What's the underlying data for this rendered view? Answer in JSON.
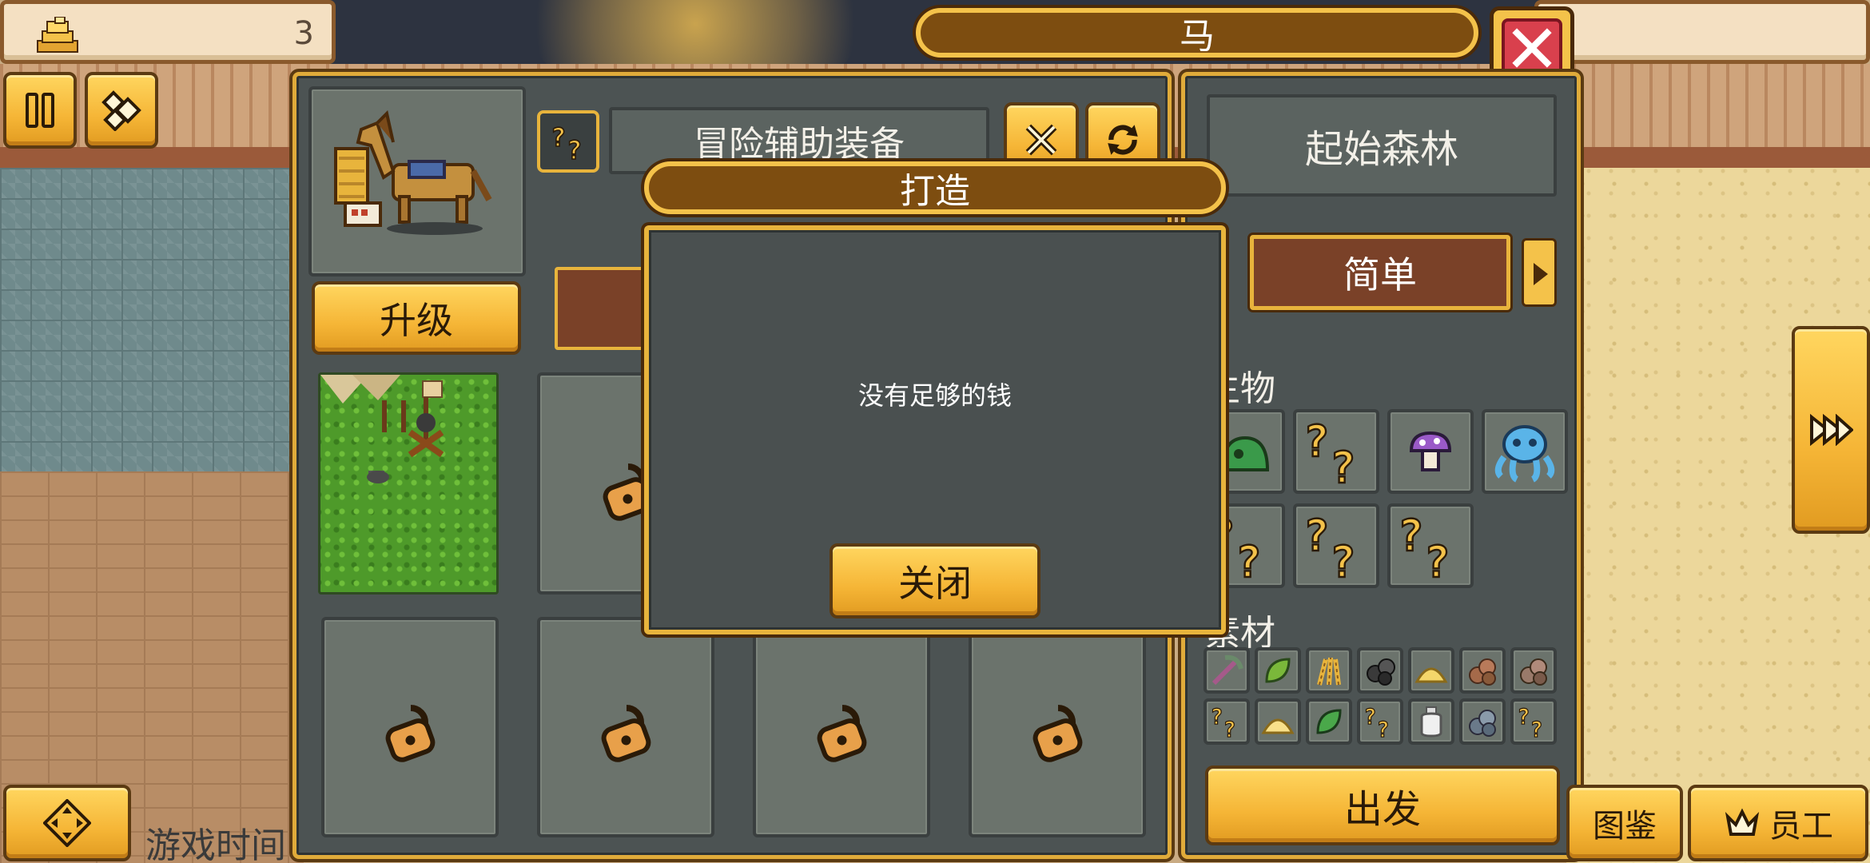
{
  "hud": {
    "coins": "3",
    "game_time_label": "游戏时间"
  },
  "header": {
    "title": "马"
  },
  "station": {
    "upgrade_label": "升级",
    "category_label": "冒险辅助装备",
    "slots_locked": 7
  },
  "expedition": {
    "region": "起始森林",
    "difficulty": "简单",
    "creatures_label": "生物",
    "materials_label": "素材",
    "depart_label": "出发"
  },
  "bottom_nav": {
    "dex_label": "图鉴",
    "staff_label": "员工"
  },
  "modal": {
    "title": "打造",
    "message": "没有足够的钱",
    "close_label": "关闭"
  },
  "colors": {
    "gold": "#f4c24a",
    "panel": "#4c5353",
    "brown": "#7d4d10",
    "close_red": "#d9404d"
  }
}
